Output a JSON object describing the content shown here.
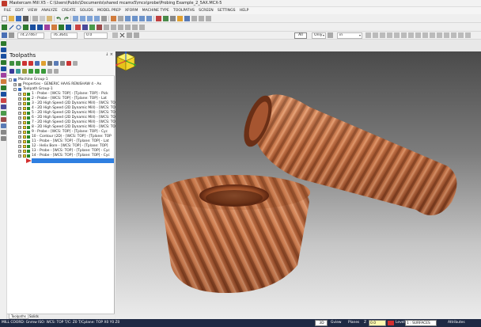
{
  "window": {
    "title": "Mastercam Mill X5 - C:\\Users\\Public\\Documents\\shared mcamx5\\mcx\\probe\\Probing Example_2_5AX.MCX-5"
  },
  "menu": [
    "FILE",
    "EDIT",
    "VIEW",
    "ANALYZE",
    "CREATE",
    "SOLIDS",
    "MODEL PREP",
    "XFORM",
    "MACHINE TYPE",
    "TOOLPATHS",
    "SCREEN",
    "SETTINGS",
    "HELP"
  ],
  "toolbar": {
    "x_field": "74.27467",
    "y_field": "76.3641",
    "z_field": "0.0",
    "all_button": "All",
    "only_combo": "Only",
    "level_combo": "in"
  },
  "toolpaths_panel": {
    "title": "Toolpaths",
    "pin_close": "↓ ×",
    "tree": {
      "machine_group": "Machine Group-1",
      "properties": "Properties - GENERIC HAAS RENISHAW 4 - Ax",
      "toolpath_group": "Toolpath Group-1",
      "operations": [
        "1 - Probe - [WCS: TOP] - [Tplane: TOP] - Pick",
        "2 - Probe - [WCS: TOP] - [Tplane: TOP] - Lat",
        "3 - 2D High Speed (2D Dynamic Mill) - [WCS: TOP",
        "4 - 2D High Speed (2D Dynamic Mill) - [WCS: TOP",
        "5 - 2D High Speed (2D Dynamic Mill) - [WCS: TOP",
        "6 - 2D High Speed (2D Dynamic Mill) - [WCS: TOP",
        "7 - 2D High Speed (2D Dynamic Mill) - [WCS: TOP",
        "8 - 2D High Speed (2D Dynamic Mill) - [WCS: TOP",
        "9 - Probe - [WCS: TOP] - [Tplane: TOP] - Cyc",
        "10 - Contour (2D) - [WCS: TOP] - [Tplane: TOP",
        "11 - Probe - [WCS: TOP] - [Tplane: TOP] - Lat",
        "12 - Helix Bore - [WCS: TOP] - [Tplane: TOP]",
        "13 - Probe - [WCS: TOP] - [Tplane: TOP] - Cyc",
        "14 - Probe - [WCS: TOP] - [Tplane: TOP] - Cyc"
      ]
    },
    "tabs": [
      "Toolpaths",
      "Solids"
    ]
  },
  "status": {
    "coords": "MILL COORD: Gnmw ISO: WCS: TOP  T/C: Z0  T/Cplane: TOP  X0  Y0  Z0",
    "view_number": "3D",
    "gview": "Gview",
    "planes": "Planes",
    "z_label": "Z",
    "z_value": "0.0",
    "level_label": "Level",
    "level_value": "1 : SURFACES",
    "attributes": "Attributes"
  },
  "colors": {
    "viewport_top": "#4a4a4a",
    "viewport_bottom": "#ececec",
    "copper": "#c8703f",
    "selection": "#2f7fe0",
    "statusbar": "#1f2a44"
  },
  "icons": {
    "gnomon": "view-cube-icon"
  }
}
